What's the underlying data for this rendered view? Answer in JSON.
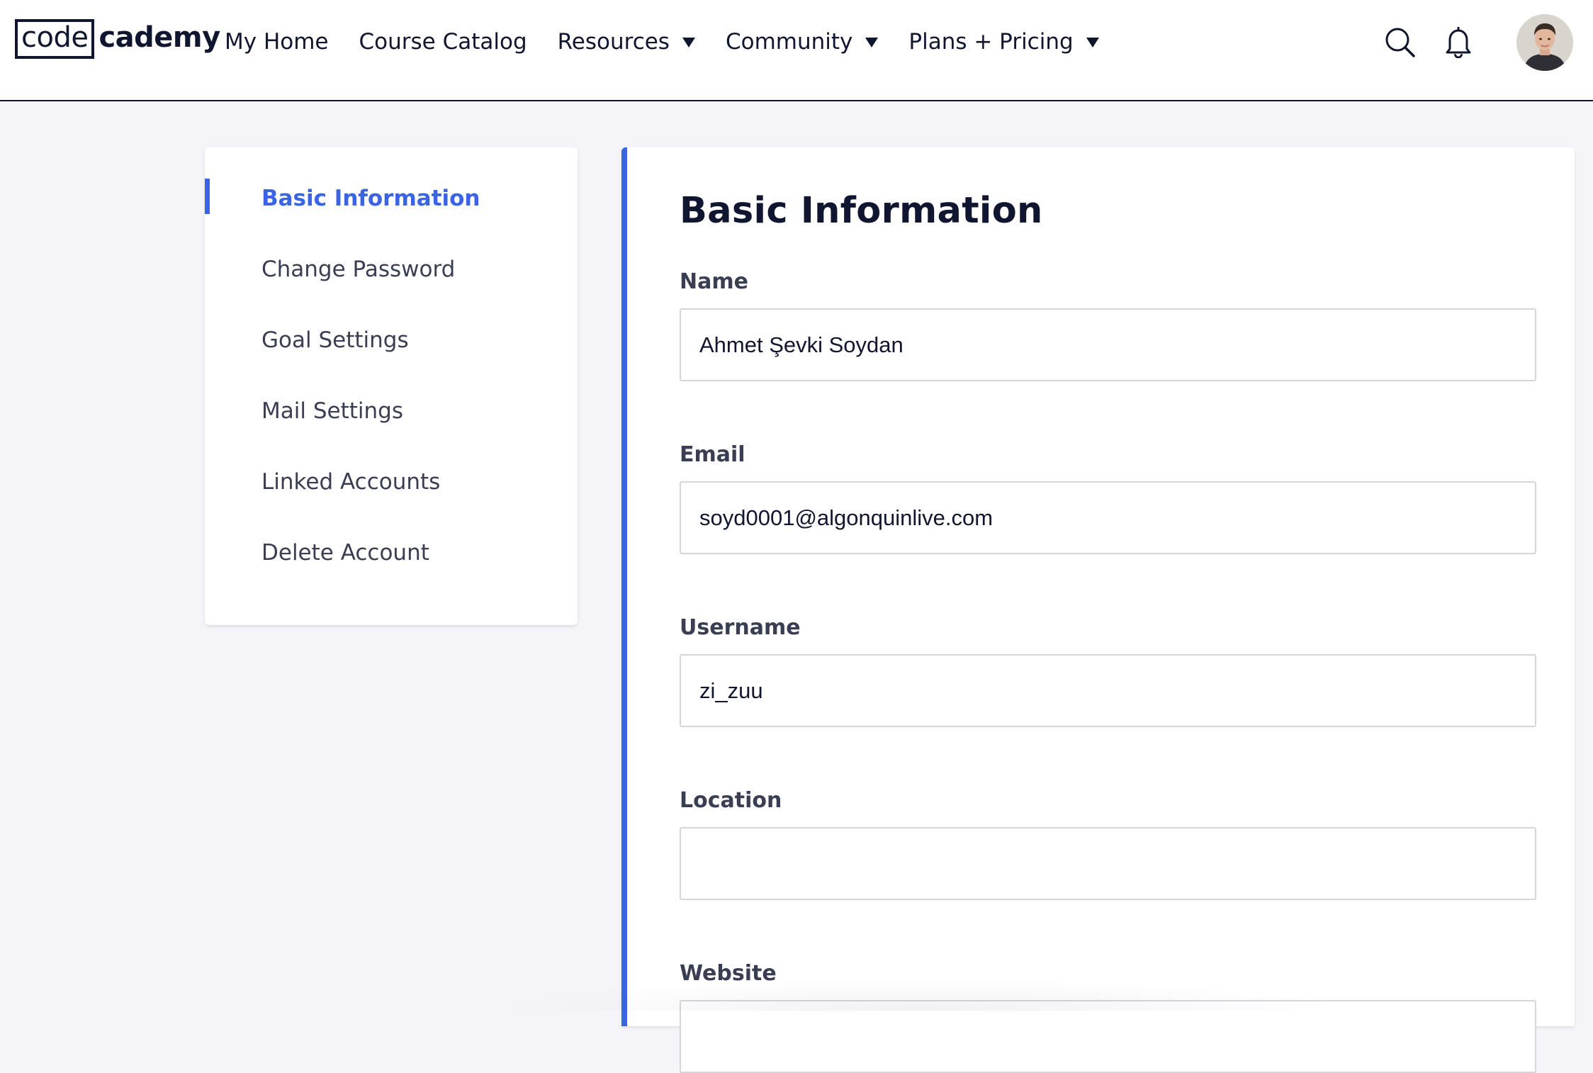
{
  "header": {
    "logo": {
      "boxed": "code",
      "rest": "cademy"
    },
    "nav": [
      {
        "label": "My Home",
        "dropdown": false
      },
      {
        "label": "Course Catalog",
        "dropdown": false
      },
      {
        "label": "Resources",
        "dropdown": true
      },
      {
        "label": "Community",
        "dropdown": true
      },
      {
        "label": "Plans + Pricing",
        "dropdown": true
      }
    ],
    "actions": {
      "search_icon": "search-icon",
      "notifications_icon": "bell-icon",
      "avatar": "user-avatar"
    }
  },
  "sidebar": {
    "items": [
      {
        "label": "Basic Information",
        "active": true
      },
      {
        "label": "Change Password",
        "active": false
      },
      {
        "label": "Goal Settings",
        "active": false
      },
      {
        "label": "Mail Settings",
        "active": false
      },
      {
        "label": "Linked Accounts",
        "active": false
      },
      {
        "label": "Delete Account",
        "active": false
      }
    ]
  },
  "main": {
    "title": "Basic Information",
    "fields": {
      "name": {
        "label": "Name",
        "value": "Ahmet Şevki Soydan"
      },
      "email": {
        "label": "Email",
        "value": "soyd0001@algonquinlive.com"
      },
      "username": {
        "label": "Username",
        "value": "zi_zuu"
      },
      "location": {
        "label": "Location",
        "value": ""
      },
      "website": {
        "label": "Website",
        "value": ""
      }
    }
  },
  "colors": {
    "accent": "#3a64e3",
    "navy": "#10162f",
    "page_bg": "#f5f5f9"
  }
}
